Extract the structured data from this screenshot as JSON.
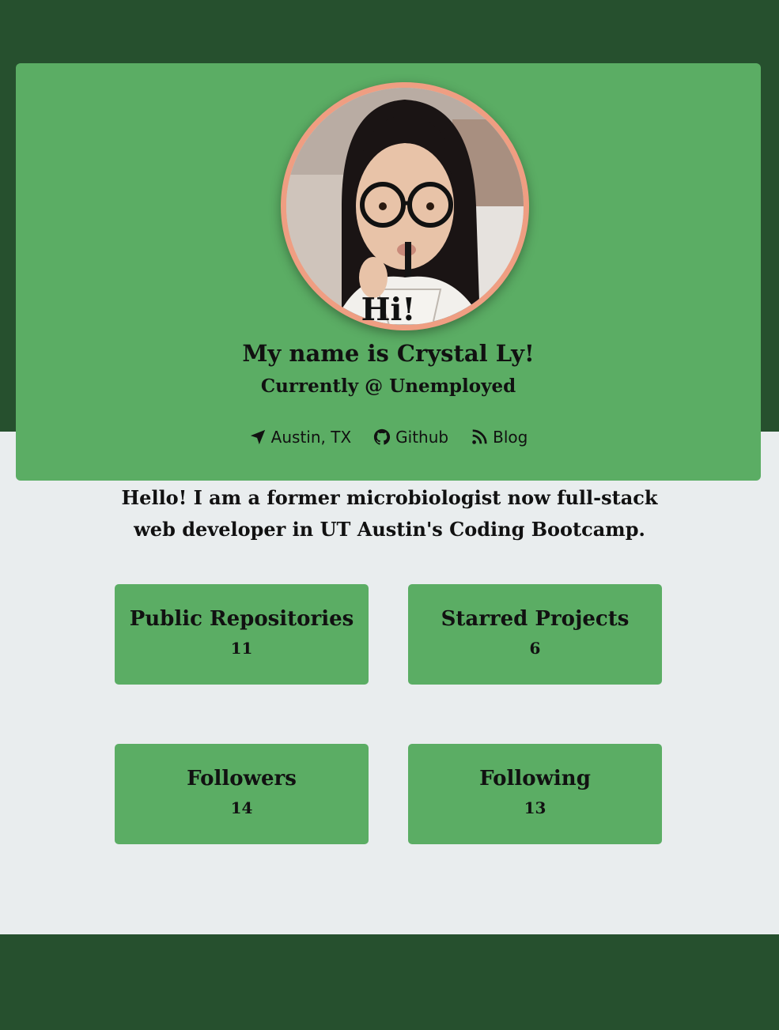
{
  "colors": {
    "header_band": "#26502e",
    "card_green": "#5bad64",
    "page_background": "#e9edee",
    "avatar_border": "#ef9e82"
  },
  "profile": {
    "greeting": "Hi!",
    "name_line": "My name is Crystal Ly!",
    "job_line": "Currently @ Unemployed",
    "avatar_icon": "profile-photo"
  },
  "links": [
    {
      "icon": "location-arrow-icon",
      "label": "Austin, TX"
    },
    {
      "icon": "github-icon",
      "label": "Github"
    },
    {
      "icon": "rss-icon",
      "label": "Blog"
    }
  ],
  "bio": "Hello! I am a former microbiologist now full-stack web developer in UT Austin's Coding Bootcamp.",
  "stats": {
    "public_repos": {
      "label": "Public Repositories",
      "value": "11"
    },
    "starred": {
      "label": "Starred Projects",
      "value": "6"
    },
    "followers": {
      "label": "Followers",
      "value": "14"
    },
    "following": {
      "label": "Following",
      "value": "13"
    }
  }
}
